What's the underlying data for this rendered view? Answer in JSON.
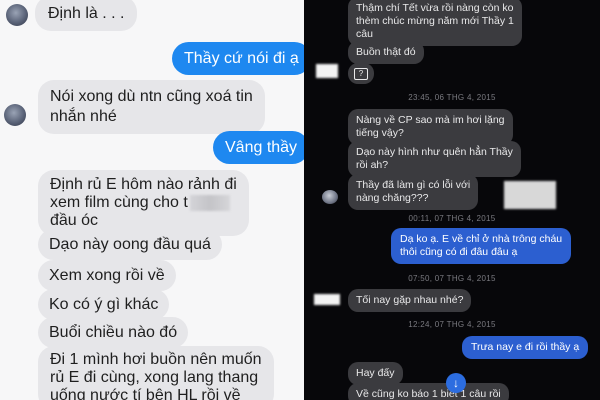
{
  "left_chat": {
    "messages": [
      {
        "from": "other",
        "text": "Định là . . ."
      },
      {
        "from": "me",
        "text": "Thầy cứ nói đi ạ"
      },
      {
        "from": "other",
        "lines": [
          "Nói xong dù ntn cũng xoá tin",
          "nhắn nhé"
        ]
      },
      {
        "from": "me",
        "text": "Vâng thầy"
      },
      {
        "from": "other",
        "lines": [
          "Định rủ E hôm nào rảnh đi",
          "xem film cùng cho t",
          "đầu óc"
        ]
      },
      {
        "from": "other",
        "text": "Dạo này oong đầu quá"
      },
      {
        "from": "other",
        "text": "Xem xong rồi về"
      },
      {
        "from": "other",
        "text": "Ko có ý gì khác"
      },
      {
        "from": "other",
        "text": "Buổi chiều nào đó"
      },
      {
        "from": "other",
        "lines": [
          "Đi 1 mình hơi buồn nên muốn",
          "rủ E đi cùng, xong lang thang",
          "uống nước tí bên HL rồi về"
        ]
      }
    ]
  },
  "right_chat": {
    "messages": [
      {
        "type": "bubble",
        "from": "other",
        "lines": [
          "Thậm chí Tết vừa rồi nàng còn ko",
          "thèm chúc mừng năm mới Thầy 1",
          "câu"
        ]
      },
      {
        "type": "bubble",
        "from": "other",
        "text": "Buồn thật đó"
      },
      {
        "type": "bubble",
        "from": "other",
        "text": "?",
        "icon": "question-box-icon"
      },
      {
        "type": "timestamp",
        "text": "23:45, 06 THG 4, 2015"
      },
      {
        "type": "bubble",
        "from": "other",
        "lines": [
          "Nàng về CP sao mà im hơi lặng",
          "tiếng vậy?"
        ]
      },
      {
        "type": "bubble",
        "from": "other",
        "lines": [
          "Dạo này hình như quên hẳn Thầy",
          "rồi ah?"
        ]
      },
      {
        "type": "bubble",
        "from": "other",
        "lines": [
          "Thầy đã làm gì có lỗi với",
          "nàng chăng???"
        ]
      },
      {
        "type": "timestamp",
        "text": "00:11, 07 THG 4, 2015"
      },
      {
        "type": "bubble",
        "from": "me",
        "lines": [
          "Dạ ko ạ. E về chỉ ở nhà trông cháu",
          "thôi cũng có đi đâu đâu ạ"
        ]
      },
      {
        "type": "timestamp",
        "text": "07:50, 07 THG 4, 2015"
      },
      {
        "type": "bubble",
        "from": "other",
        "text": "Tối nay gặp nhau nhé?"
      },
      {
        "type": "timestamp",
        "text": "12:24, 07 THG 4, 2015"
      },
      {
        "type": "bubble",
        "from": "me",
        "text": "Trưa nay e đi rồi thầy ạ"
      },
      {
        "type": "bubble",
        "from": "other",
        "text": "Hay đấy"
      },
      {
        "type": "bubble",
        "from": "other",
        "text": "Về cũng ko báo 1     biết 1 câu rồi"
      }
    ]
  },
  "colors": {
    "left_incoming_bubble": "#e6e6e9",
    "left_outgoing_bubble": "#1e88f0",
    "right_background": "#07070a",
    "right_incoming_bubble": "#3b3b3f",
    "right_outgoing_bubble": "#2c5fd0"
  },
  "icons": [
    "avatar",
    "question-box-icon",
    "scroll-down-arrow-icon"
  ]
}
